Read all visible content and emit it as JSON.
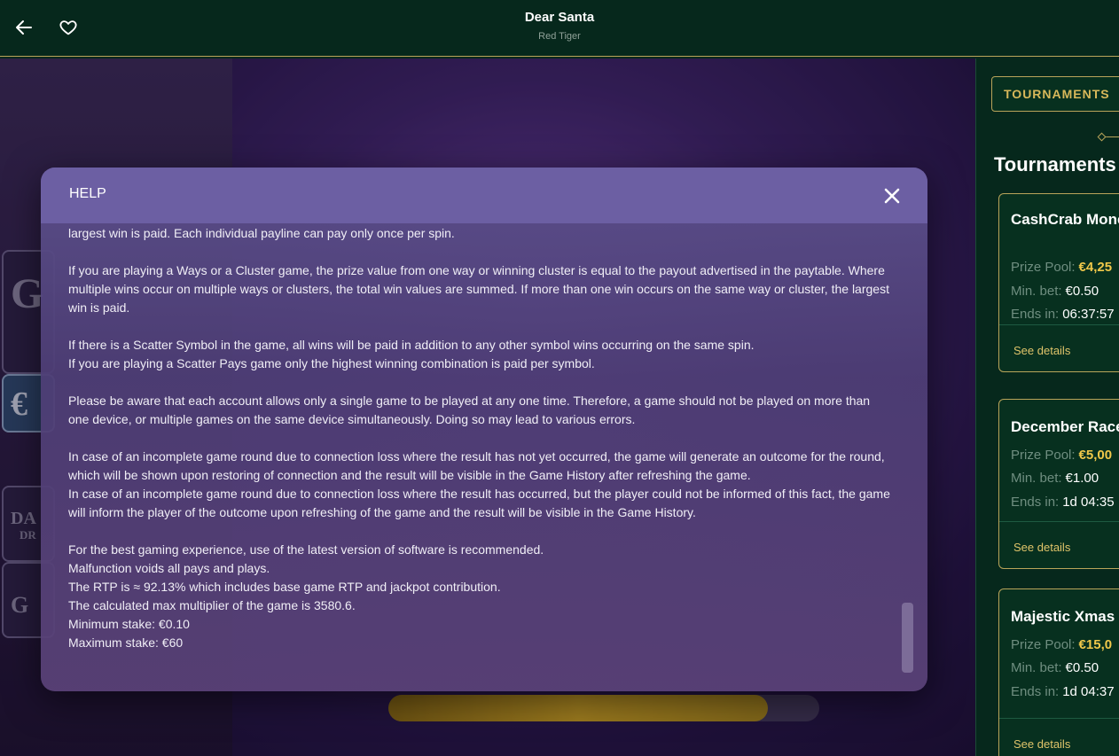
{
  "header": {
    "title": "Dear Santa",
    "subtitle": "Red Tiger",
    "back_icon": "arrow-left-icon",
    "favorite_icon": "heart-icon"
  },
  "game_bg": {
    "tiles": [
      "G",
      "€",
      "DA",
      "DR",
      "G"
    ],
    "progress_fraction": 0.88
  },
  "sidebar": {
    "badge": "TOURNAMENTS",
    "heading": "Tournaments",
    "cards": [
      {
        "name": "CashCrab Money Race",
        "prize_label": "Prize Pool:",
        "prize_value": "€4,25",
        "minbet_label": "Min. bet:",
        "minbet_value": "€0.50",
        "ends_label": "Ends in:",
        "ends_value": "06:37:57",
        "details": "See details"
      },
      {
        "name": "December Race",
        "prize_label": "Prize Pool:",
        "prize_value": "€5,00",
        "minbet_label": "Min. bet:",
        "minbet_value": "€1.00",
        "ends_label": "Ends in:",
        "ends_value": "1d 04:35",
        "details": "See details"
      },
      {
        "name": "Majestic Xmas",
        "prize_label": "Prize Pool:",
        "prize_value": "€15,0",
        "minbet_label": "Min. bet:",
        "minbet_value": "€0.50",
        "ends_label": "Ends in:",
        "ends_value": "1d 04:37",
        "details": "See details"
      }
    ]
  },
  "modal": {
    "title": "HELP",
    "close_icon": "close-icon",
    "paragraphs": [
      "largest win is paid. Each individual payline can pay only once per spin.",
      "If you are playing a Ways or a Cluster game, the prize value from one way or winning cluster is equal to the payout advertised in the paytable. Where multiple wins occur on multiple ways or clusters, the total win values are summed. If more than one win occurs on the same way or cluster, the largest win is paid.",
      "If there is a Scatter Symbol in the game, all wins will be paid in addition to any other symbol wins occurring on the same spin.",
      "If you are playing a Scatter Pays game only the highest winning combination is paid per symbol.",
      "Please be aware that each account allows only a single game to be played at any one time. Therefore, a game should not be played on more than one device, or multiple games on the same device simultaneously. Doing so may lead to various errors.",
      "In case of an incomplete game round due to connection loss where the result has not yet occurred, the game will generate an outcome for the round, which will be shown upon restoring of connection and the result will be visible in the Game History after refreshing the game.",
      "In case of an incomplete game round due to connection loss where the result has occurred, but the player could not be informed of this fact, the game will inform the player of the outcome upon refreshing of the game and the result will be visible in the Game History.",
      "For the best gaming experience, use of the latest version of software is recommended.",
      "Malfunction voids all pays and plays.",
      "The RTP is ≈ 92.13% which includes base game RTP and jackpot contribution.",
      "The calculated max multiplier of the game is 3580.6.",
      "Minimum stake: €0.10",
      "Maximum stake: €60"
    ]
  }
}
